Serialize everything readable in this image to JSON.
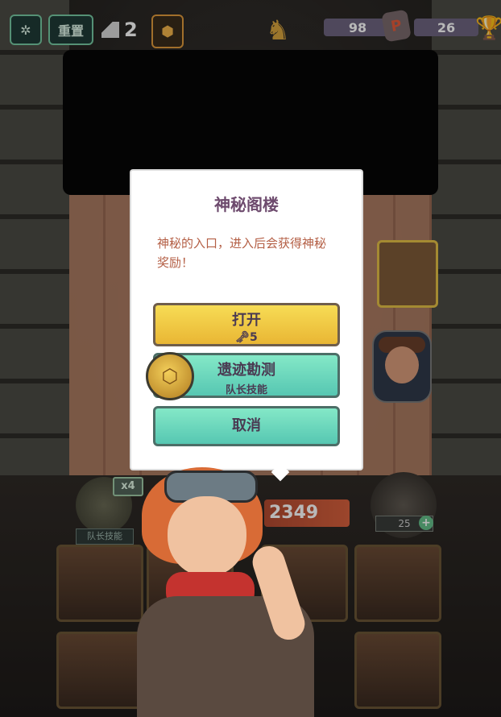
{
  "hud": {
    "reset_label": "重置",
    "floor_number": "2",
    "keys_count": "98",
    "trophies_count": "26",
    "badge_letter": "P"
  },
  "dialog": {
    "title": "神秘阁楼",
    "description": "神秘的入口，进入后会获得神秘奖励！",
    "open_label": "打开",
    "open_cost": "5",
    "survey_label": "遗迹勘测",
    "survey_sub": "队长技能",
    "cancel_label": "取消"
  },
  "bottom": {
    "skill_count": "x4",
    "skill_label": "队长技能",
    "hp_value": "2349",
    "torch_value": "25"
  },
  "colors": {
    "accent_green": "#56c7b2",
    "accent_yellow": "#e9b634",
    "title_purple": "#6d4a6d",
    "desc_orange": "#b45f45"
  },
  "icons": {
    "settings": "gear-icon",
    "stairs": "stairs-icon",
    "bag": "backpack-icon",
    "helmet": "helmet-icon",
    "trophy": "trophy-icon",
    "key": "key-icon",
    "coin": "coin-icon"
  }
}
